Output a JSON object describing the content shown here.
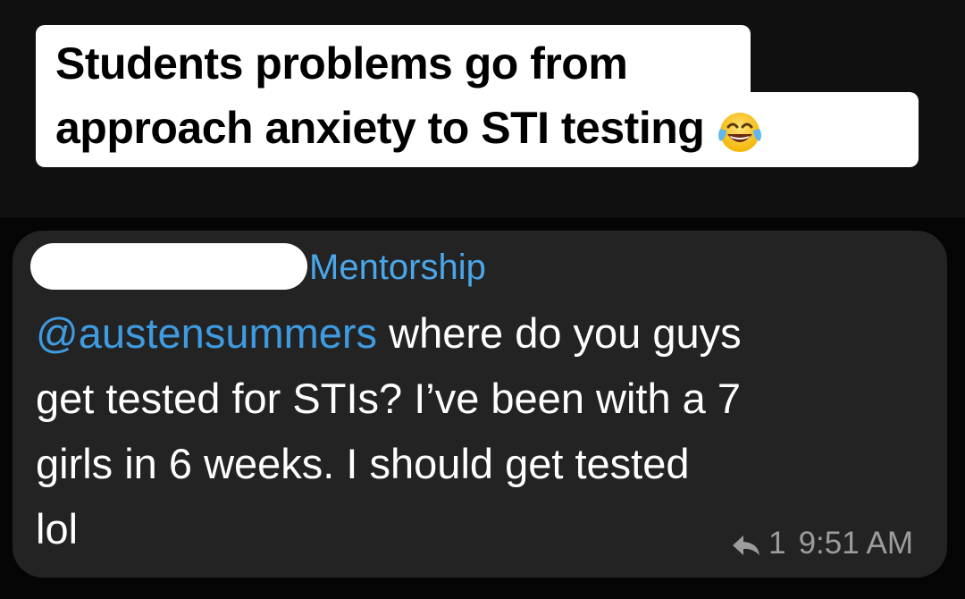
{
  "caption": {
    "line1": "Students problems go from",
    "line2": "approach anxiety to STI testing",
    "emoji": "face-with-tears-of-joy-icon"
  },
  "message": {
    "group_name": "Mentorship",
    "mention": "@austensummers",
    "line1_rest": " where do you guys",
    "line2": "get tested for STIs? I’ve been with a 7",
    "line3": "girls in 6 weeks. I should get tested",
    "line4": "lol",
    "reply_icon": "reply-arrow-icon",
    "reply_count": "1",
    "time": "9:51 AM"
  },
  "colors": {
    "mention": "#3e9be0",
    "group_name": "#4aa6e8",
    "bubble": "#232323",
    "meta": "#9c9c9c"
  }
}
